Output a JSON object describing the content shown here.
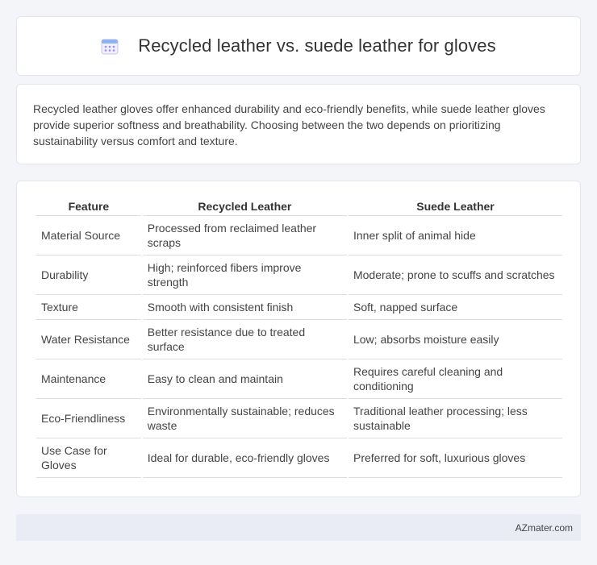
{
  "header": {
    "title": "Recycled leather vs. suede leather for gloves",
    "icon": "calendar-icon"
  },
  "summary": {
    "text": "Recycled leather gloves offer enhanced durability and eco-friendly benefits, while suede leather gloves provide superior softness and breathability. Choosing between the two depends on prioritizing sustainability versus comfort and texture."
  },
  "table": {
    "headers": [
      "Feature",
      "Recycled Leather",
      "Suede Leather"
    ],
    "rows": [
      [
        "Material Source",
        "Processed from reclaimed leather scraps",
        "Inner split of animal hide"
      ],
      [
        "Durability",
        "High; reinforced fibers improve strength",
        "Moderate; prone to scuffs and scratches"
      ],
      [
        "Texture",
        "Smooth with consistent finish",
        "Soft, napped surface"
      ],
      [
        "Water Resistance",
        "Better resistance due to treated surface",
        "Low; absorbs moisture easily"
      ],
      [
        "Maintenance",
        "Easy to clean and maintain",
        "Requires careful cleaning and conditioning"
      ],
      [
        "Eco-Friendliness",
        "Environmentally sustainable; reduces waste",
        "Traditional leather processing; less sustainable"
      ],
      [
        "Use Case for Gloves",
        "Ideal for durable, eco-friendly gloves",
        "Preferred for soft, luxurious gloves"
      ]
    ]
  },
  "footer": {
    "brand": "AZmater.com"
  },
  "colors": {
    "background": "#f4f5f9",
    "icon_accent": "#7b6fe0",
    "icon_header": "#e57373"
  }
}
